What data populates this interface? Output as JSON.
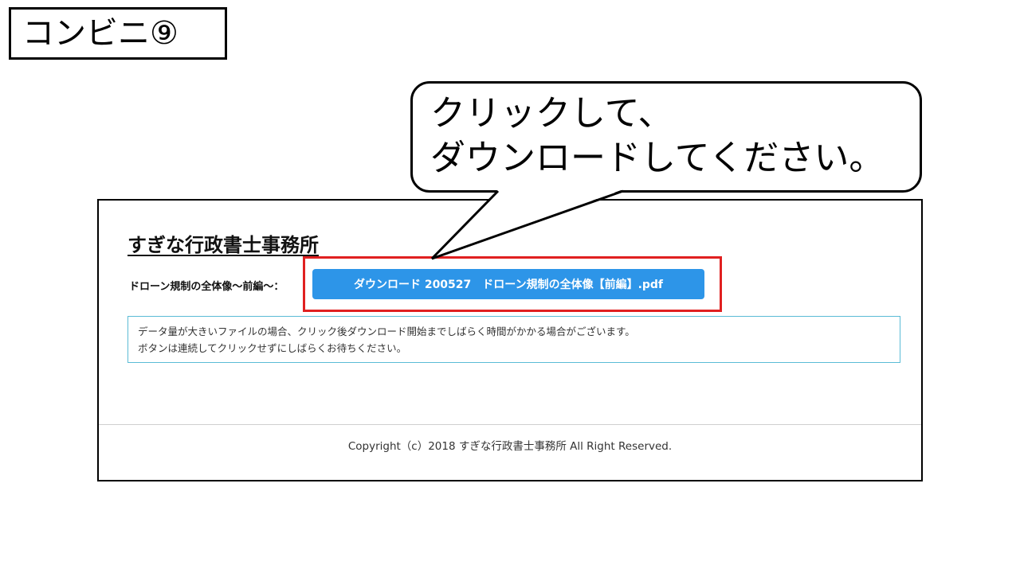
{
  "step_label": "コンビニ⑨",
  "callout": {
    "line1": "クリックして、",
    "line2": "ダウンロードしてください。"
  },
  "site": {
    "title": "すぎな行政書士事務所",
    "download_label": "ドローン規制の全体像〜前編〜：",
    "download_button": "ダウンロード 200527　ドローン規制の全体像【前編】.pdf",
    "notice_line1": "データ量が大きいファイルの場合、クリック後ダウンロード開始までしばらく時間がかかる場合がございます。",
    "notice_line2": "ボタンは連続してクリックせずにしばらくお待ちください。",
    "footer": "Copyright（c）2018 すぎな行政書士事務所 All Right Reserved."
  },
  "colors": {
    "button": "#2d95e8",
    "highlight": "#e02020",
    "notice_border": "#5bbcd6"
  }
}
